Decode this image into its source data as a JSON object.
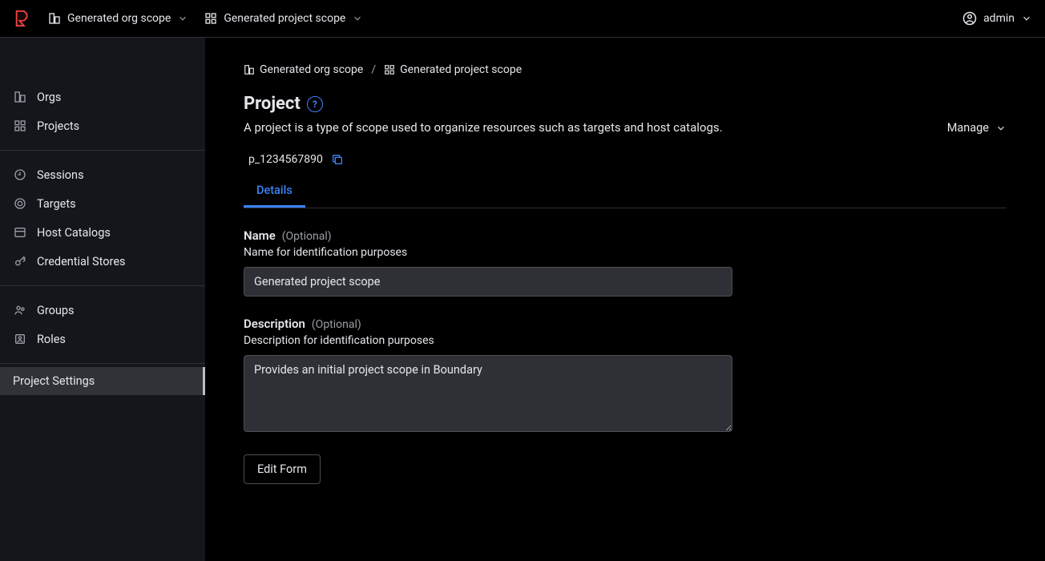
{
  "header": {
    "org_scope_label": "Generated org scope",
    "project_scope_label": "Generated project scope",
    "user_label": "admin"
  },
  "sidebar": {
    "items": [
      {
        "label": "Orgs"
      },
      {
        "label": "Projects"
      },
      {
        "label": "Sessions"
      },
      {
        "label": "Targets"
      },
      {
        "label": "Host Catalogs"
      },
      {
        "label": "Credential Stores"
      },
      {
        "label": "Groups"
      },
      {
        "label": "Roles"
      },
      {
        "label": "Project Settings"
      }
    ]
  },
  "breadcrumb": {
    "org": "Generated org scope",
    "project": "Generated project scope"
  },
  "page": {
    "title": "Project",
    "subtitle": "A project is a type of scope used to organize resources such as targets and host catalogs.",
    "manage_label": "Manage",
    "id": "p_1234567890"
  },
  "tabs": {
    "details": "Details"
  },
  "form": {
    "name": {
      "label": "Name",
      "optional": "(Optional)",
      "help": "Name for identification purposes",
      "value": "Generated project scope"
    },
    "description": {
      "label": "Description",
      "optional": "(Optional)",
      "help": "Description for identification purposes",
      "value": "Provides an initial project scope in Boundary"
    },
    "edit_button": "Edit Form"
  }
}
